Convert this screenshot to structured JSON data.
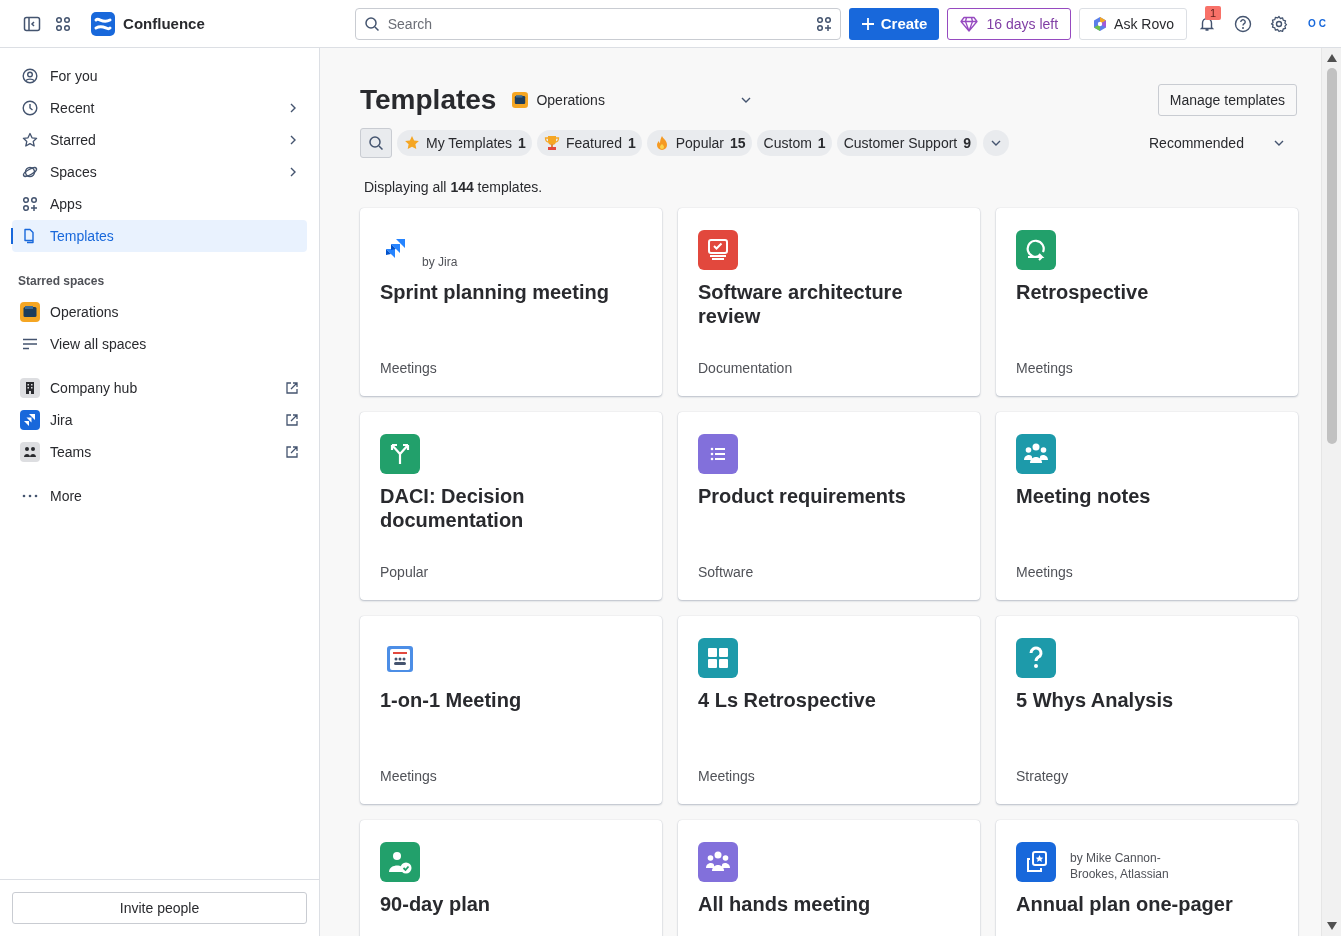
{
  "topbar": {
    "product": "Confluence",
    "search": {
      "placeholder": "Search"
    },
    "create": "Create",
    "trial": "16 days left",
    "ask": "Ask Rovo",
    "notifications": "1",
    "avatar": "O C"
  },
  "sidebar": {
    "nav": [
      {
        "label": "For you",
        "chevron": false,
        "selected": false
      },
      {
        "label": "Recent",
        "chevron": true,
        "selected": false
      },
      {
        "label": "Starred",
        "chevron": true,
        "selected": false
      },
      {
        "label": "Spaces",
        "chevron": true,
        "selected": false
      },
      {
        "label": "Apps",
        "chevron": false,
        "selected": false
      },
      {
        "label": "Templates",
        "chevron": false,
        "selected": true
      }
    ],
    "starred_heading": "Starred spaces",
    "spaces": [
      {
        "label": "Operations"
      },
      {
        "label": "View all spaces"
      }
    ],
    "links": [
      {
        "label": "Company hub",
        "external": true
      },
      {
        "label": "Jira",
        "external": true
      },
      {
        "label": "Teams",
        "external": true
      }
    ],
    "more": "More",
    "invite": "Invite people"
  },
  "main": {
    "title": "Templates",
    "space": "Operations",
    "manage": "Manage templates",
    "filters": [
      {
        "label": "My Templates",
        "count": "1",
        "selected": false
      },
      {
        "label": "Featured",
        "count": "1",
        "selected": false
      },
      {
        "label": "Popular",
        "count": "15",
        "selected": false
      },
      {
        "label": "Custom",
        "count": "1",
        "selected": false
      },
      {
        "label": "Customer Support",
        "count": "9",
        "selected": false
      }
    ],
    "sort": "Recommended",
    "summary": "Displaying all **144** templates.",
    "cards": [
      {
        "kind": "jira",
        "byline": "by Jira",
        "title": "Sprint planning meeting",
        "category": "Meetings"
      },
      {
        "kind": "monitor",
        "title": "Software architecture review",
        "category": "Documentation"
      },
      {
        "kind": "loop",
        "title": "Retrospective",
        "category": "Meetings"
      },
      {
        "kind": "fork",
        "title": "DACI: Decision documentation",
        "category": "Popular"
      },
      {
        "kind": "list",
        "title": "Product requirements",
        "category": "Software"
      },
      {
        "kind": "people",
        "title": "Meeting notes",
        "category": "Meetings"
      },
      {
        "kind": "notes",
        "title": "1-on-1 Meeting",
        "category": "Meetings"
      },
      {
        "kind": "grid",
        "title": "4 Ls Retrospective",
        "category": "Meetings"
      },
      {
        "kind": "question",
        "title": "5 Whys Analysis",
        "category": "Strategy"
      },
      {
        "kind": "personcheck",
        "title": "90-day plan"
      },
      {
        "kind": "group",
        "title": "All hands meeting"
      },
      {
        "kind": "starbox",
        "byline": "by Mike Cannon-Brookes, Atlassian",
        "title": "Annual plan one-pager"
      }
    ]
  }
}
